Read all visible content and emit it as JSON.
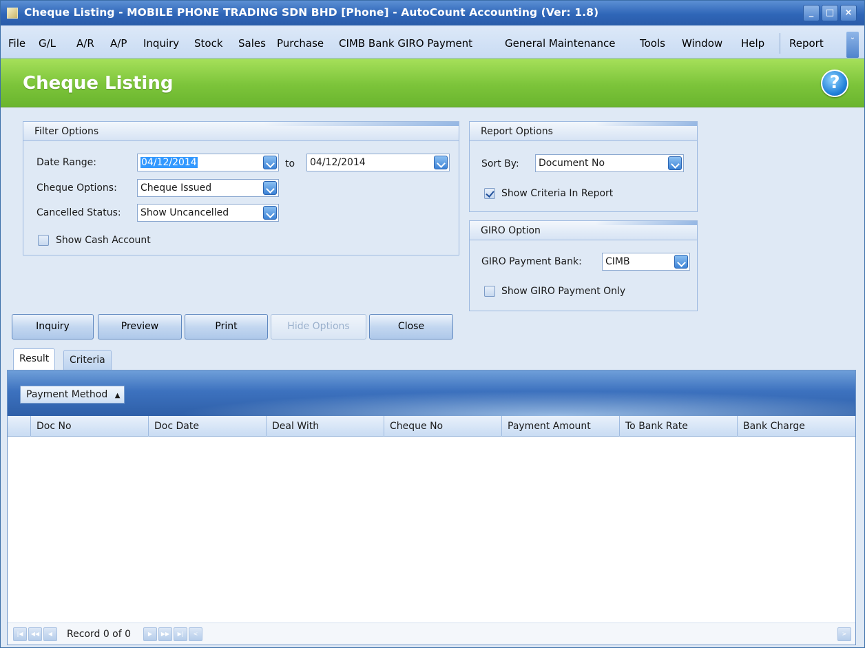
{
  "window": {
    "title": "Cheque Listing - MOBILE PHONE TRADING SDN BHD [Phone] - AutoCount Accounting (Ver: 1.8)",
    "controls": [
      "minimize",
      "maximize",
      "close"
    ]
  },
  "menu": {
    "items": [
      "File",
      "G/L",
      "A/R",
      "A/P",
      "Inquiry",
      "Stock",
      "Sales",
      "Purchase",
      "CIMB Bank GIRO Payment",
      "General Maintenance",
      "Tools",
      "Window",
      "Help",
      "Report"
    ]
  },
  "header": {
    "title": "Cheque Listing",
    "help_icon": "?"
  },
  "filter": {
    "title": "Filter Options",
    "date_range_label": "Date Range:",
    "date_from": "04/12/2014",
    "to_label": "to",
    "date_to": "04/12/2014",
    "cheque_options_label": "Cheque Options:",
    "cheque_options_value": "Cheque Issued",
    "cancelled_label": "Cancelled Status:",
    "cancelled_value": "Show Uncancelled",
    "show_cash_label": "Show Cash Account",
    "show_cash_checked": false
  },
  "report": {
    "title": "Report Options",
    "sort_by_label": "Sort By:",
    "sort_by_value": "Document No",
    "show_criteria_label": "Show Criteria In Report",
    "show_criteria_checked": true
  },
  "giro": {
    "title": "GIRO Option",
    "bank_label": "GIRO Payment Bank:",
    "bank_value": "CIMB",
    "show_giro_label": "Show GIRO Payment Only",
    "show_giro_checked": false
  },
  "buttons": {
    "inquiry": "Inquiry",
    "preview": "Preview",
    "print": "Print",
    "hide_options": "Hide Options",
    "close": "Close"
  },
  "tabs": {
    "result": "Result",
    "criteria": "Criteria",
    "active": "Result"
  },
  "grid": {
    "group_by": "Payment Method",
    "columns": [
      "Doc No",
      "Doc Date",
      "Deal With",
      "Cheque No",
      "Payment Amount",
      "To Bank Rate",
      "Bank Charge"
    ],
    "rows": [],
    "record_text": "Record 0 of 0"
  }
}
